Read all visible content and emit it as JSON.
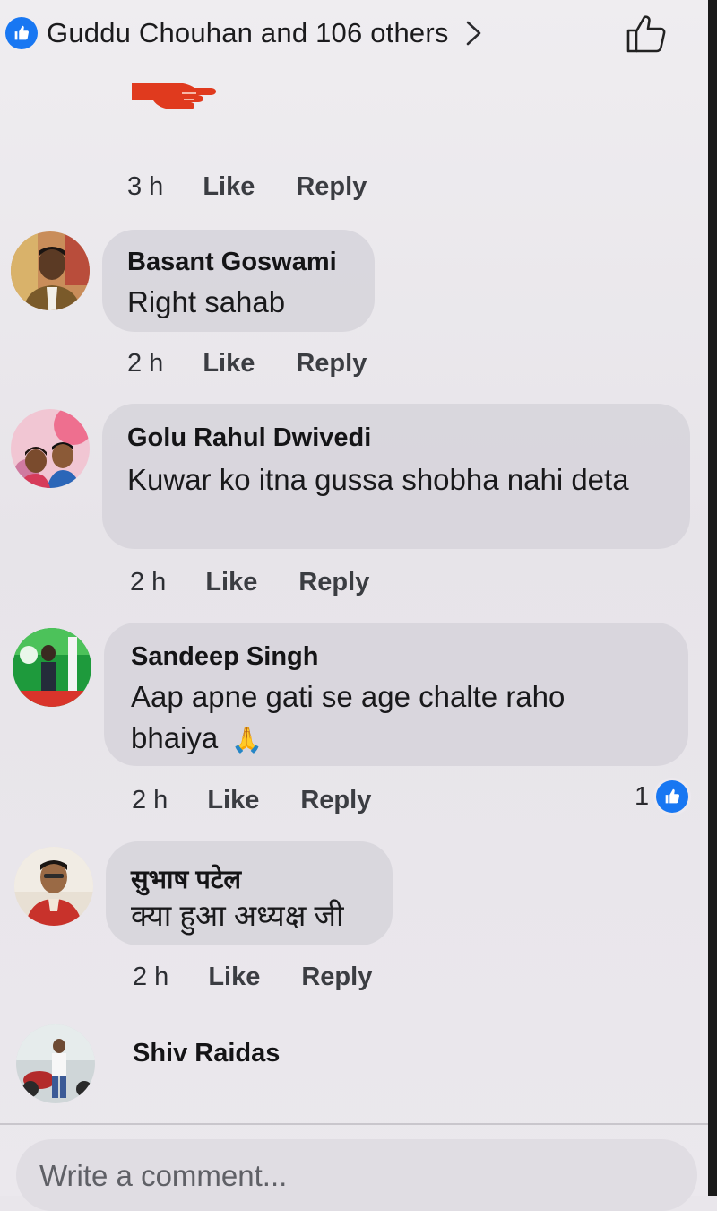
{
  "header": {
    "reactors_text": "Guddu Chouhan and 106 others"
  },
  "first_comment_actions": {
    "time": "3 h",
    "like": "Like",
    "reply": "Reply"
  },
  "comments": [
    {
      "author": "Basant Goswami",
      "text": "Right sahab",
      "time": "2 h",
      "like": "Like",
      "reply": "Reply"
    },
    {
      "author": "Golu Rahul Dwivedi",
      "text": "Kuwar ko itna gussa shobha nahi deta",
      "time": "2 h",
      "like": "Like",
      "reply": "Reply"
    },
    {
      "author": "Sandeep Singh",
      "text": "Aap apne gati se age chalte raho bhaiya",
      "emoji": "🙏",
      "time": "2 h",
      "like": "Like",
      "reply": "Reply",
      "reaction_count": "1"
    },
    {
      "author": "सुभाष पटेल",
      "text": "क्या हुआ अध्यक्ष जी",
      "time": "2 h",
      "like": "Like",
      "reply": "Reply"
    },
    {
      "author": "Shiv Raidas"
    }
  ],
  "composer": {
    "placeholder": "Write a comment..."
  },
  "colors": {
    "accent": "#1877f2",
    "background": "#e9e6eb",
    "bubble": "#d6d3da"
  },
  "icons": {
    "reaction_badge": "like-icon",
    "post_like": "thumbs-up-outline-icon",
    "open_reactions": "chevron-right-icon",
    "sticker": "pointing-hand-icon"
  }
}
